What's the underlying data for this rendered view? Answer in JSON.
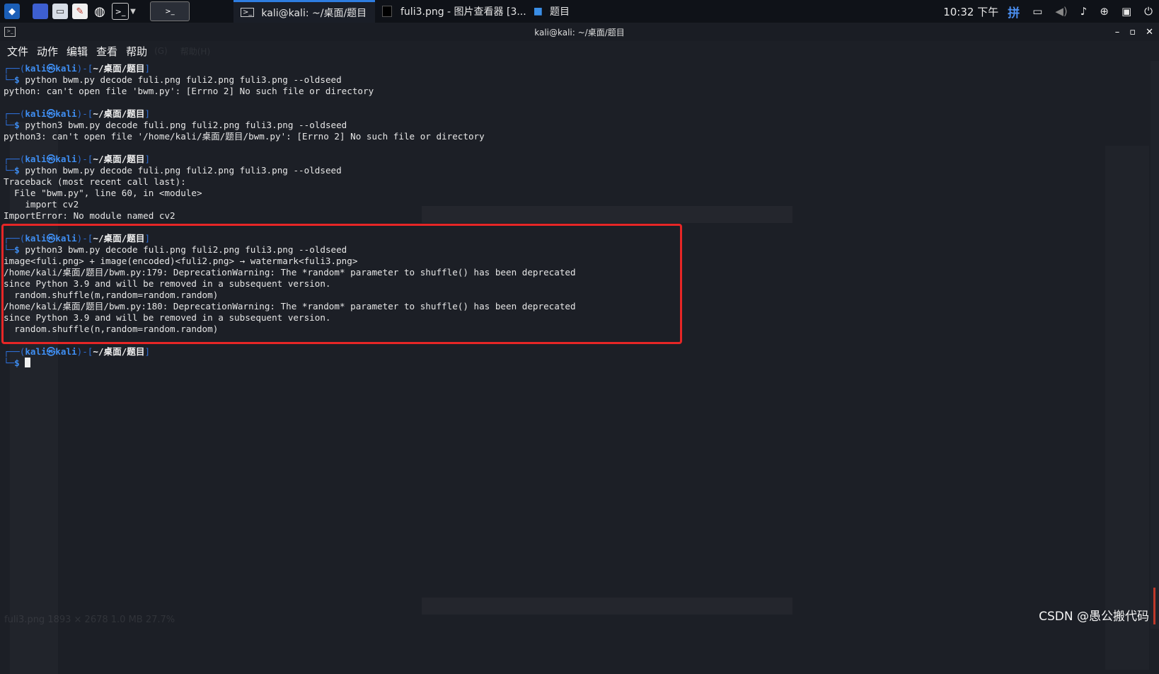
{
  "panel": {
    "task_terminal": "kali@kali: ~/桌面/题目",
    "task_viewer": "fuli3.png - 图片查看器 [3...",
    "task_folder": "题目",
    "clock": "10:32 下午",
    "ime": "拼"
  },
  "window": {
    "title": "kali@kali: ~/桌面/题目"
  },
  "menu": [
    "文件",
    "动作",
    "编辑",
    "查看",
    "帮助"
  ],
  "terminal": {
    "user": "kali",
    "host": "kali",
    "path": "~/桌面/题目",
    "blocks": [
      {
        "cmd": "python bwm.py decode fuli.png fuli2.png fuli3.png --oldseed",
        "out": [
          "python: can't open file 'bwm.py': [Errno 2] No such file or directory"
        ]
      },
      {
        "cmd": "python3 bwm.py decode fuli.png fuli2.png fuli3.png --oldseed",
        "out": [
          "python3: can't open file '/home/kali/桌面/题目/bwm.py': [Errno 2] No such file or directory"
        ]
      },
      {
        "cmd": "python bwm.py decode fuli.png fuli2.png fuli3.png --oldseed",
        "out": [
          "Traceback (most recent call last):",
          "  File \"bwm.py\", line 60, in <module>",
          "    import cv2",
          "ImportError: No module named cv2"
        ]
      },
      {
        "cmd": "python3 bwm.py decode fuli.png fuli2.png fuli3.png --oldseed",
        "out": [
          "image<fuli.png> + image(encoded)<fuli2.png> → watermark<fuli3.png>",
          "/home/kali/桌面/题目/bwm.py:179: DeprecationWarning: The *random* parameter to shuffle() has been deprecated",
          "since Python 3.9 and will be removed in a subsequent version.",
          "  random.shuffle(m,random=random.random)",
          "/home/kali/桌面/题目/bwm.py:180: DeprecationWarning: The *random* parameter to shuffle() has been deprecated",
          "since Python 3.9 and will be removed in a subsequent version.",
          "  random.shuffle(n,random=random.random)"
        ]
      }
    ]
  },
  "ghost": {
    "menu_extra1": "(G)",
    "menu_extra2": "帮助(H)",
    "status": "fuli3.png    1893 × 2678    1.0 MB    27.7%"
  },
  "watermark": "CSDN @愚公搬代码",
  "colors": {
    "highlight": "#e62626",
    "prompt_blue": "#3f8ef2",
    "panel_accent": "#2e7de0"
  }
}
